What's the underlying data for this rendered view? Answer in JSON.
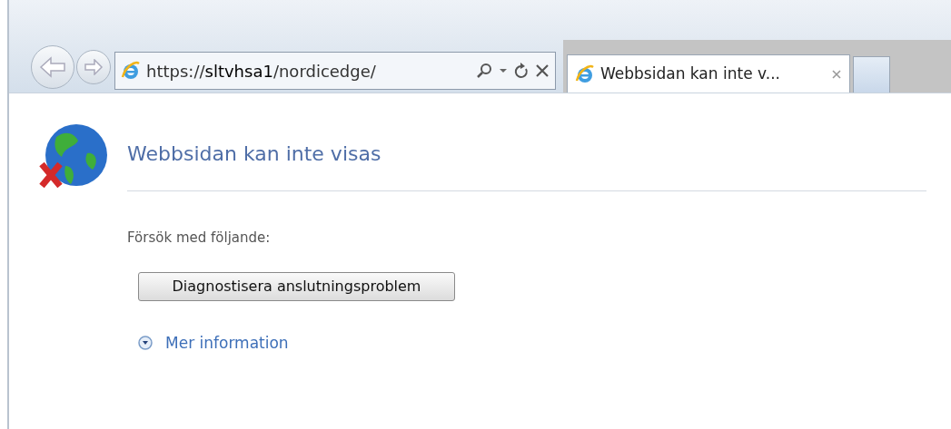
{
  "browser": {
    "address": "https://**sltvhsa1**/nordicedge/",
    "tabs": [
      {
        "label": "Webbsidan kan inte v...",
        "selected": true
      }
    ]
  },
  "page": {
    "heading": "Webbsidan kan inte visas",
    "prompt": "Försök med följande:",
    "button": "Diagnostisera anslutningsproblem",
    "more": {
      "label": "Mer information",
      "expanded": false
    }
  }
}
